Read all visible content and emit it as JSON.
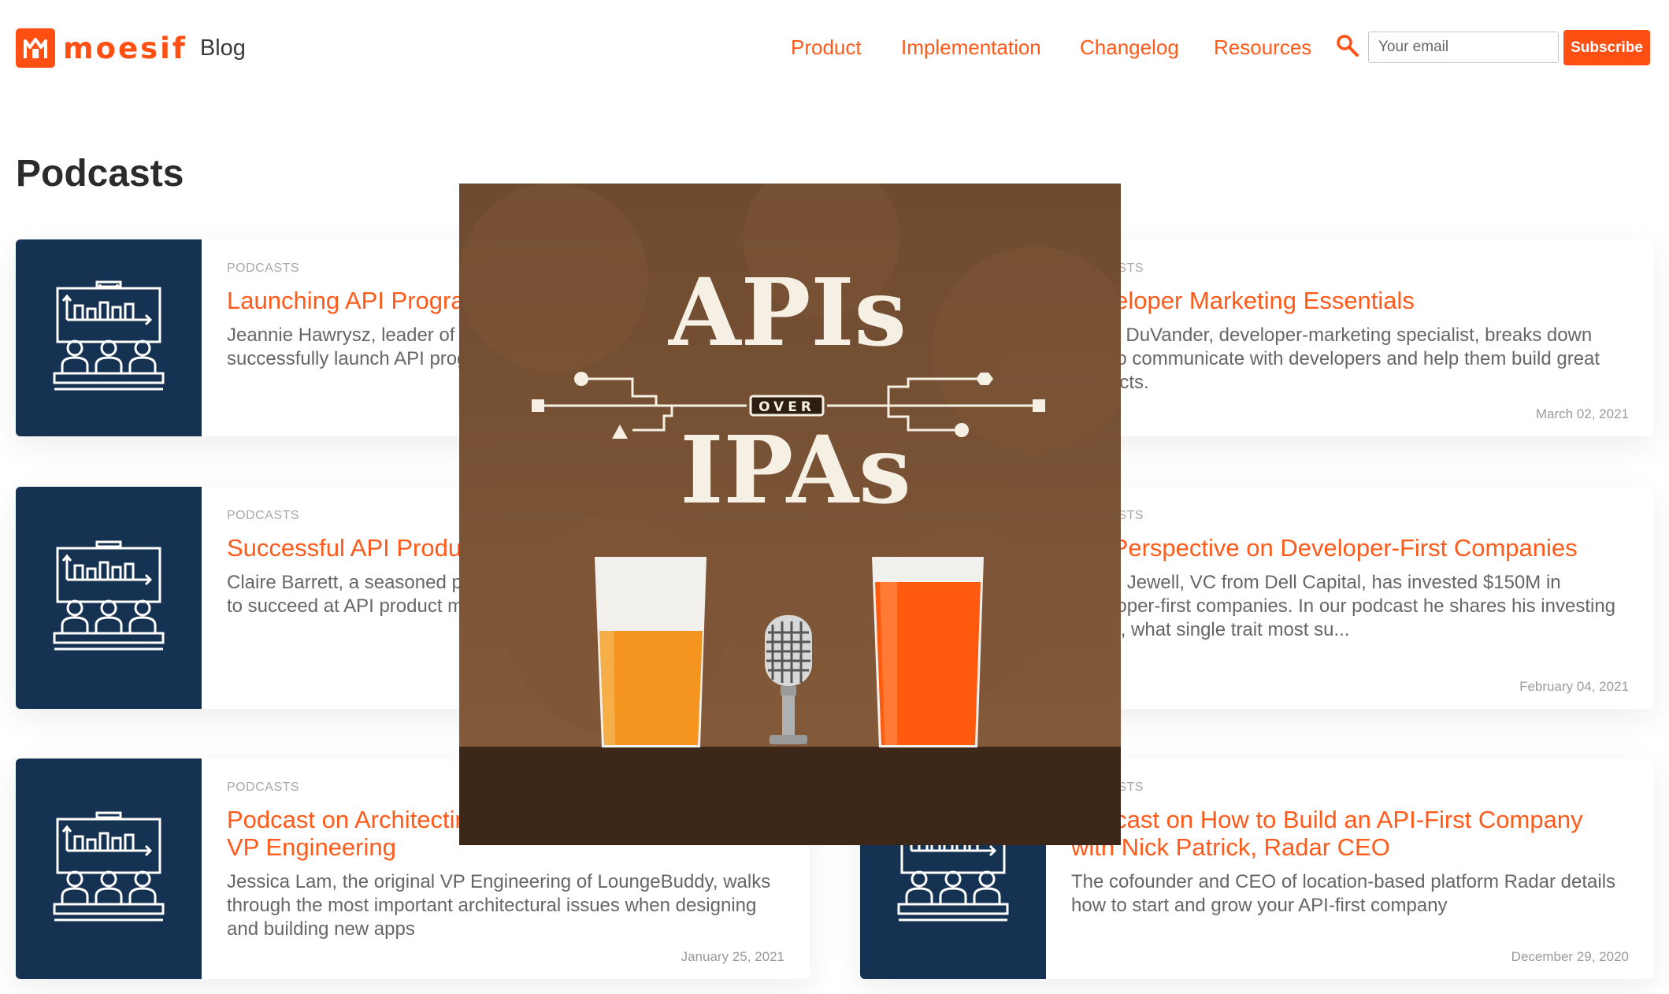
{
  "header": {
    "logo_text": "moesif",
    "blog_label": "Blog",
    "nav": [
      "Product",
      "Implementation",
      "Changelog",
      "Resources"
    ],
    "email_placeholder": "Your email",
    "subscribe_label": "Subscribe",
    "colors": {
      "brand": "#ff4f12",
      "nav": "#ff5a1a"
    }
  },
  "page_title": "Podcasts",
  "cards": [
    {
      "tag": "PODCASTS",
      "title": "Launching API Programs in Non-Tech Companies",
      "desc": "Jeannie Hawrysz, leader of API programs, explains how to successfully launch API programs in non-tech companies.",
      "date": ""
    },
    {
      "tag": "PODCASTS",
      "title": "Developer Marketing Essentials",
      "desc": "Adam DuVander, developer-marketing specialist, breaks down how to communicate with developers and help them build great products.",
      "date": "March 02, 2021"
    },
    {
      "tag": "PODCASTS",
      "title": "Successful API Product Management in Enterprises",
      "desc": "Claire Barrett, a seasoned product manager, explains what it takes to succeed at API product management in mature organizations.",
      "date": ""
    },
    {
      "tag": "PODCASTS",
      "title": "VC Perspective on Developer-First Companies",
      "desc": "Jason Jewell, VC from Dell Capital, has invested $150M in developer-first companies. In our podcast he shares his investing thesis, what single trait most su...",
      "date": "February 04, 2021"
    },
    {
      "tag": "PODCASTS",
      "title": "Podcast on Architecting Apps with LoungeBuddy VP Engineering",
      "desc": "Jessica Lam, the original VP Engineering of LoungeBuddy, walks through the most important architectural issues when designing and building new apps",
      "date": "January 25, 2021"
    },
    {
      "tag": "PODCASTS",
      "title": "Podcast on How to Build an API-First Company with Nick Patrick, Radar CEO",
      "desc": "The cofounder and CEO of location-based platform Radar details how to start and grow your API-first company",
      "date": "December 29, 2020"
    }
  ],
  "overlay": {
    "line1": "APIs",
    "over": "OVER",
    "line2": "IPAs",
    "icons": [
      "beer-glass-icon",
      "microphone-icon",
      "beer-glass-icon"
    ]
  }
}
